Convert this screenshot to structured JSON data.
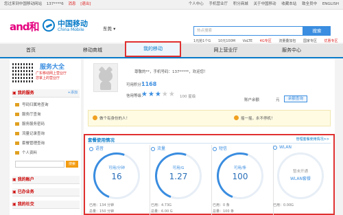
{
  "topbar": {
    "welcome": "您过来到中国移动网站",
    "user": "137****6 ",
    "messages": "消息",
    "logout": "[退出]",
    "links": [
      "个人中心",
      "手机营业厅",
      "积分商城",
      "关于中国移动",
      "收藏本站",
      "致全员中",
      "ENGLISH"
    ]
  },
  "header": {
    "brand_and": "and和",
    "brand_cn": "中国移动",
    "brand_en": "China Mobile",
    "city": "东莞",
    "search_placeholder": "热点搜索",
    "search_button": "搜索",
    "hot_links": [
      "1元抢1个G",
      "10元100M",
      "VoLTE",
      "4G专区",
      "流量叠加包",
      "国家专区",
      "优惠专区"
    ]
  },
  "nav": {
    "items": [
      "首页",
      "移动商城",
      "我的移动",
      "网上营业厅",
      "服务中心"
    ]
  },
  "sidebar": {
    "service_title": "服务大全",
    "service_sub1": "广东移动网上营业厅",
    "service_sub2": "您掌上的营业厅",
    "my_services_title": "我的服务",
    "my_services_add": "+添加",
    "services": [
      "号码归属地查询",
      "服务厅查询",
      "服务服务密码",
      "流量记录查询",
      "套餐管理查询",
      "个人资料"
    ],
    "search_button": "搜索",
    "sections": [
      "我的账户",
      "已办业务",
      "我的社交"
    ]
  },
  "profile": {
    "greeting": "尊敬的**，手机号码：137*****，欢迎您！",
    "points_label": "可用积分：",
    "points_value": "1168",
    "stars_label": "信用等级：",
    "stars_filled": 3,
    "stars_total": 5,
    "stars_text": "100 星级",
    "balance_label": "账户余额",
    "balance_unit": "元",
    "balance_button": "余额查询"
  },
  "notice": {
    "left": "做个有身份的人！",
    "right": "摇一摇，永不停机！"
  },
  "usage": {
    "title": "套餐使用情况",
    "more": "管理套餐使用情况>>",
    "cards": [
      {
        "label": "语音",
        "cap": "可用/分钟",
        "value": "16",
        "used": "已用：134 分钟",
        "total": "总量：150 分钟"
      },
      {
        "label": "流量",
        "cap": "可用/G",
        "value": "1.27",
        "used": "已用：4.73G",
        "total": "总量：6.00 G"
      },
      {
        "label": "短信",
        "cap": "可用/条",
        "value": "100",
        "used": "已用：0 条",
        "total": "总量：100 条"
      },
      {
        "label": "WLAN",
        "cap": "暂未开通",
        "value": "WLAN套餐",
        "used": "已用：0.00G",
        "total": ""
      }
    ]
  },
  "colors": {
    "accent": "#3a8de0",
    "brand": "#0a7cc9",
    "highlight_box": "#e03030"
  }
}
